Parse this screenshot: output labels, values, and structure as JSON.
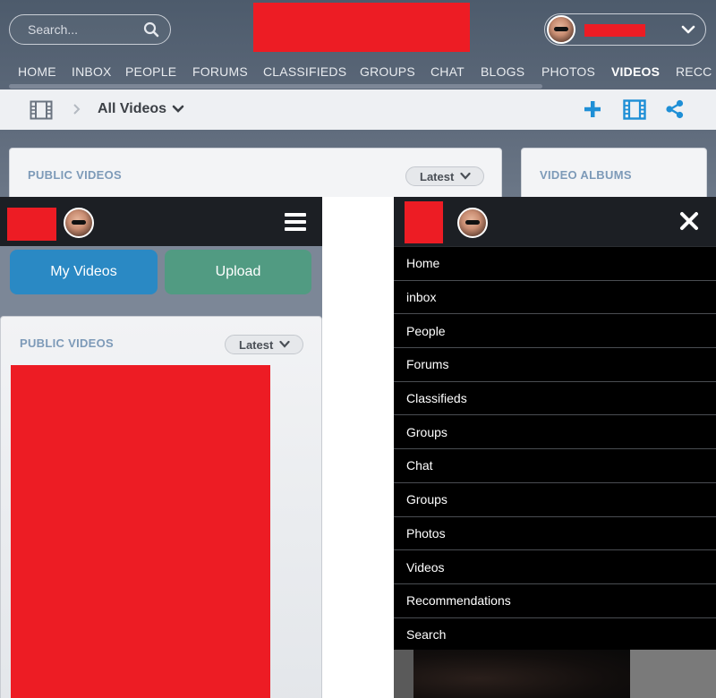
{
  "desktop": {
    "search": {
      "placeholder": "Search..."
    },
    "nav": [
      "HOME",
      "INBOX",
      "PEOPLE",
      "FORUMS",
      "CLASSIFIEDS",
      "GROUPS",
      "CHAT",
      "BLOGS",
      "PHOTOS",
      "VIDEOS",
      "RECC"
    ],
    "active_nav": "VIDEOS",
    "breadcrumb": {
      "label": "All Videos"
    },
    "panels": {
      "public_videos": {
        "title": "PUBLIC VIDEOS",
        "sort": "Latest"
      },
      "video_albums": {
        "title": "VIDEO ALBUMS"
      }
    },
    "colors": {
      "accent": "#1e8fd6",
      "logo": "#ed1c24"
    }
  },
  "mobile": {
    "my_videos": "My Videos",
    "upload": "Upload",
    "panel": {
      "title": "PUBLIC VIDEOS",
      "sort": "Latest"
    },
    "colors": {
      "my_videos_bg": "#2a89c4",
      "upload_bg": "#519b82"
    }
  },
  "mobile_menu": {
    "items": [
      "Home",
      "inbox",
      "People",
      "Forums",
      "Classifieds",
      "Groups",
      "Chat",
      "Groups",
      "Photos",
      "Videos",
      "Recommendations",
      "Search"
    ]
  }
}
